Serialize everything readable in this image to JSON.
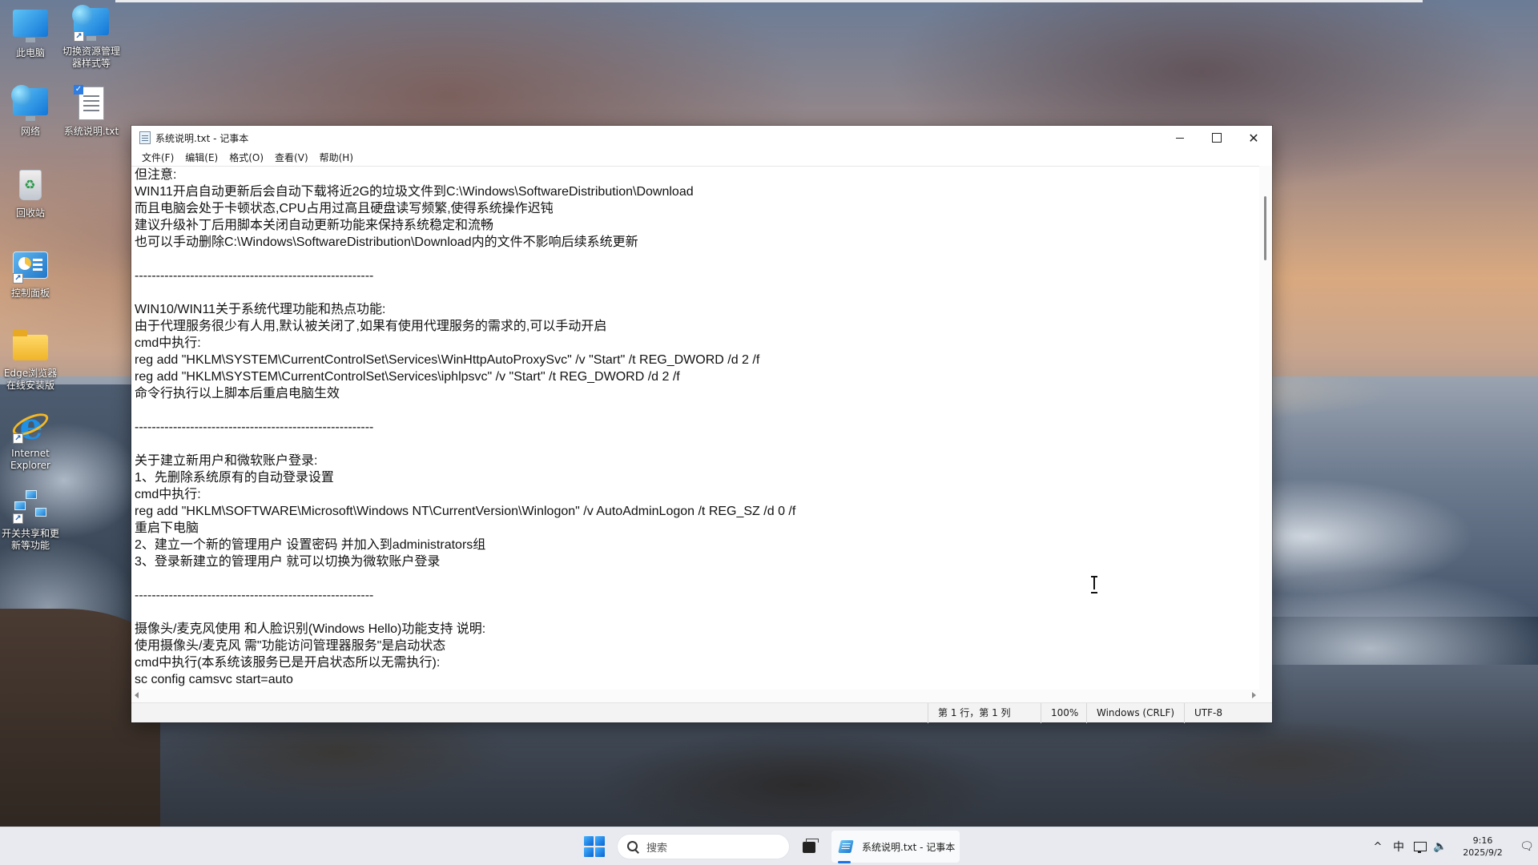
{
  "desktop": {
    "icons": [
      {
        "label": "此电脑",
        "icon": "this-pc-icon"
      },
      {
        "label": "切换资源管理器样式等",
        "icon": "explorer-switch-icon"
      },
      {
        "label": "网络",
        "icon": "network-icon"
      },
      {
        "label": "系统说明.txt",
        "icon": "text-file-icon"
      },
      {
        "label": "回收站",
        "icon": "recycle-bin-icon"
      },
      {
        "label": "控制面板",
        "icon": "control-panel-icon"
      },
      {
        "label": "Edge浏览器在线安装版",
        "icon": "folder-icon"
      },
      {
        "label": "Internet Explorer",
        "icon": "internet-explorer-icon"
      },
      {
        "label": "开关共享和更新等功能",
        "icon": "network-share-icon"
      }
    ]
  },
  "notepad": {
    "title": "系统说明.txt - 记事本",
    "menu": [
      "文件(F)",
      "编辑(E)",
      "格式(O)",
      "查看(V)",
      "帮助(H)"
    ],
    "lines": [
      "但注意:",
      "WIN11开启自动更新后会自动下载将近2G的垃圾文件到C:\\Windows\\SoftwareDistribution\\Download",
      "而且电脑会处于卡顿状态,CPU占用过高且硬盘读写频繁,使得系统操作迟钝",
      "建议升级补丁后用脚本关闭自动更新功能来保持系统稳定和流畅",
      "也可以手动删除C:\\Windows\\SoftwareDistribution\\Download内的文件不影响后续系统更新",
      "",
      "--------------------------------------------------------",
      "",
      "WIN10/WIN11关于系统代理功能和热点功能:",
      "由于代理服务很少有人用,默认被关闭了,如果有使用代理服务的需求的,可以手动开启",
      "cmd中执行:",
      "reg add \"HKLM\\SYSTEM\\CurrentControlSet\\Services\\WinHttpAutoProxySvc\" /v \"Start\" /t REG_DWORD /d 2 /f",
      "reg add \"HKLM\\SYSTEM\\CurrentControlSet\\Services\\iphlpsvc\" /v \"Start\" /t REG_DWORD /d 2 /f",
      "命令行执行以上脚本后重启电脑生效",
      "",
      "--------------------------------------------------------",
      "",
      "关于建立新用户和微软账户登录:",
      "1、先删除系统原有的自动登录设置",
      "cmd中执行:",
      "reg add \"HKLM\\SOFTWARE\\Microsoft\\Windows NT\\CurrentVersion\\Winlogon\" /v AutoAdminLogon /t REG_SZ /d 0 /f",
      "重启下电脑",
      "2、建立一个新的管理用户 设置密码 并加入到administrators组",
      "3、登录新建立的管理用户 就可以切换为微软账户登录",
      "",
      "--------------------------------------------------------",
      "",
      "摄像头/麦克风使用 和人脸识别(Windows Hello)功能支持 说明:",
      "使用摄像头/麦克风 需\"功能访问管理器服务\"是启动状态",
      "cmd中执行(本系统该服务已是开启状态所以无需执行):",
      "sc config camsvc start=auto"
    ],
    "status": {
      "position": "第 1 行，第 1 列",
      "zoom": "100%",
      "line_ending": "Windows (CRLF)",
      "encoding": "UTF-8"
    }
  },
  "taskbar": {
    "search_placeholder": "搜索",
    "running_app_label": "系统说明.txt - 记事本",
    "tray": {
      "chevron": "^",
      "ime": "中",
      "time": "9:16",
      "date": "2025/9/2"
    }
  }
}
